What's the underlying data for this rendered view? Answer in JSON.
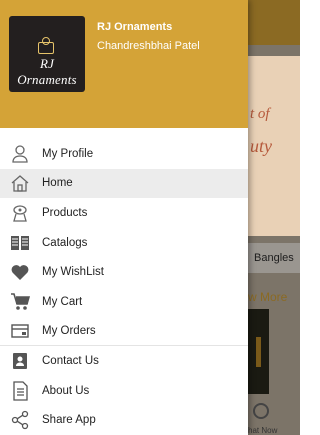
{
  "header": {
    "logo_text": "RJ Ornaments",
    "shop_name": "RJ Ornaments",
    "owner_name": "Chandreshbhai Patel",
    "background_color": "#d4a337"
  },
  "menu": [
    {
      "label": "My Profile",
      "icon": "profile-icon",
      "active": false
    },
    {
      "label": "Home",
      "icon": "home-icon",
      "active": true
    },
    {
      "label": "Products",
      "icon": "products-icon",
      "active": false
    },
    {
      "label": "Catalogs",
      "icon": "catalogs-icon",
      "active": false
    },
    {
      "label": "My WishList",
      "icon": "heart-icon",
      "active": false
    },
    {
      "label": "My Cart",
      "icon": "cart-icon",
      "active": false
    },
    {
      "label": "My Orders",
      "icon": "orders-icon",
      "active": false
    },
    {
      "label": "Contact Us",
      "icon": "contact-icon",
      "active": false
    },
    {
      "label": "About Us",
      "icon": "about-icon",
      "active": false
    },
    {
      "label": "Share App",
      "icon": "share-icon",
      "active": false
    }
  ],
  "background_app": {
    "banner_line1": "t of",
    "banner_line2": "uty",
    "tab_label": "Bangles",
    "know_more": "w More",
    "chat_label": "hat Now"
  }
}
